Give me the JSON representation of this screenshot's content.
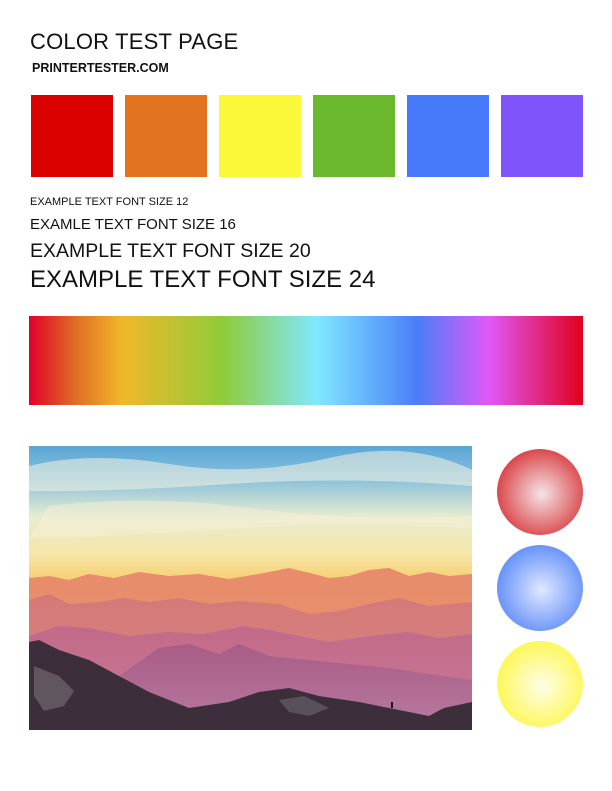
{
  "header": {
    "title": "COLOR TEST PAGE",
    "subtitle": "PRINTERTESTER.COM"
  },
  "swatches": [
    {
      "name": "red",
      "color": "#da0000"
    },
    {
      "name": "orange",
      "color": "#e2731f"
    },
    {
      "name": "yellow",
      "color": "#fbf83a"
    },
    {
      "name": "green",
      "color": "#6ab82e"
    },
    {
      "name": "blue",
      "color": "#4779fb"
    },
    {
      "name": "purple",
      "color": "#7f55fb"
    }
  ],
  "samples": {
    "size12": "EXAMPLE TEXT FONT SIZE 12",
    "size16": "EXAMLE TEXT FONT SIZE 16",
    "size20": "EXAMPLE TEXT FONT SIZE 20",
    "size24": "EXAMPLE TEXT FONT SIZE 24"
  },
  "rainbow": {
    "stops": [
      "#e0002a",
      "#e06a25",
      "#f0b82a",
      "#8fcc3a",
      "#80e8ff",
      "#4a7ef8",
      "#e058f8",
      "#e0001a"
    ]
  },
  "photo": {
    "subject": "mountain sunset landscape with hiker silhouette"
  },
  "circles": [
    {
      "name": "red",
      "edge": "#d8383c",
      "center": "#f4e4e6"
    },
    {
      "name": "blue",
      "edge": "#5c8af8",
      "center": "#dfe8ff"
    },
    {
      "name": "yellow",
      "edge": "#fcf74a",
      "center": "#fffde8"
    }
  ]
}
